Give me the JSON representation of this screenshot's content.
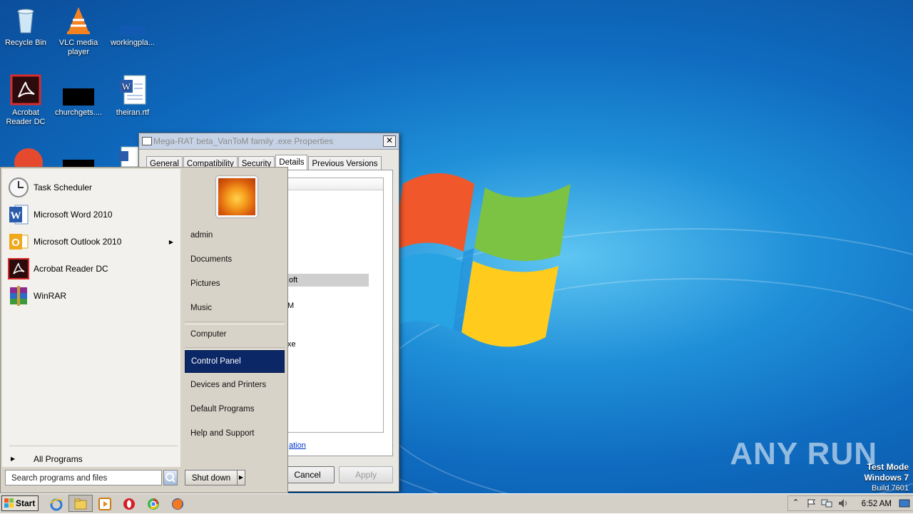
{
  "desktop": {
    "icons": [
      {
        "label": "Recycle Bin",
        "icon": "recycle-bin-icon"
      },
      {
        "label": "VLC media player",
        "icon": "vlc-icon"
      },
      {
        "label": "workingpla...",
        "icon": "blue-file-icon"
      },
      {
        "label": "Acrobat Reader DC",
        "icon": "acrobat-icon"
      },
      {
        "label": "churchgets....",
        "icon": "black-file-icon"
      },
      {
        "label": "theiran.rtf",
        "icon": "word-document-icon"
      }
    ],
    "watermark": "ANY RUN",
    "test_mode": {
      "line1": "Test Mode",
      "line2": "Windows 7",
      "line3": "Build 7601"
    }
  },
  "dialog": {
    "title": "Mega-RAT beta_VanToM family .exe Properties",
    "tabs": [
      "General",
      "Compatibility",
      "Security",
      "Details",
      "Previous Versions"
    ],
    "active_tab": "Details",
    "fragments": [
      "oft",
      "M",
      "xe"
    ],
    "link_fragment": "ation",
    "cancel_label": "Cancel",
    "apply_label": "Apply"
  },
  "start_menu": {
    "programs": [
      {
        "label": "Task Scheduler",
        "icon": "task-scheduler-icon",
        "has_submenu": false
      },
      {
        "label": "Microsoft Word 2010",
        "icon": "word-icon",
        "has_submenu": false
      },
      {
        "label": "Microsoft Outlook 2010",
        "icon": "outlook-icon",
        "has_submenu": true
      },
      {
        "label": "Acrobat Reader DC",
        "icon": "acrobat-icon",
        "has_submenu": false
      },
      {
        "label": "WinRAR",
        "icon": "winrar-icon",
        "has_submenu": false
      }
    ],
    "all_programs": "All Programs",
    "search_placeholder": "Search programs and files",
    "right_links": [
      "admin",
      "Documents",
      "Pictures",
      "Music",
      "Computer",
      "Control Panel",
      "Devices and Printers",
      "Default Programs",
      "Help and Support"
    ],
    "selected_link": "Control Panel",
    "shutdown_label": "Shut down"
  },
  "taskbar": {
    "start_label": "Start",
    "pinned": [
      "internet-explorer-icon",
      "explorer-icon",
      "media-player-icon",
      "opera-icon",
      "chrome-icon",
      "firefox-icon"
    ],
    "clock": "6:52 AM",
    "tray_icons": [
      "show-hidden-icon",
      "action-center-flag-icon",
      "network-icon",
      "volume-icon",
      "show-desktop-icon"
    ]
  },
  "colors": {
    "desktop_blue": "#1f8fd8",
    "selection_navy": "#0b2766",
    "taskbar_gray": "#d4d0c8"
  }
}
